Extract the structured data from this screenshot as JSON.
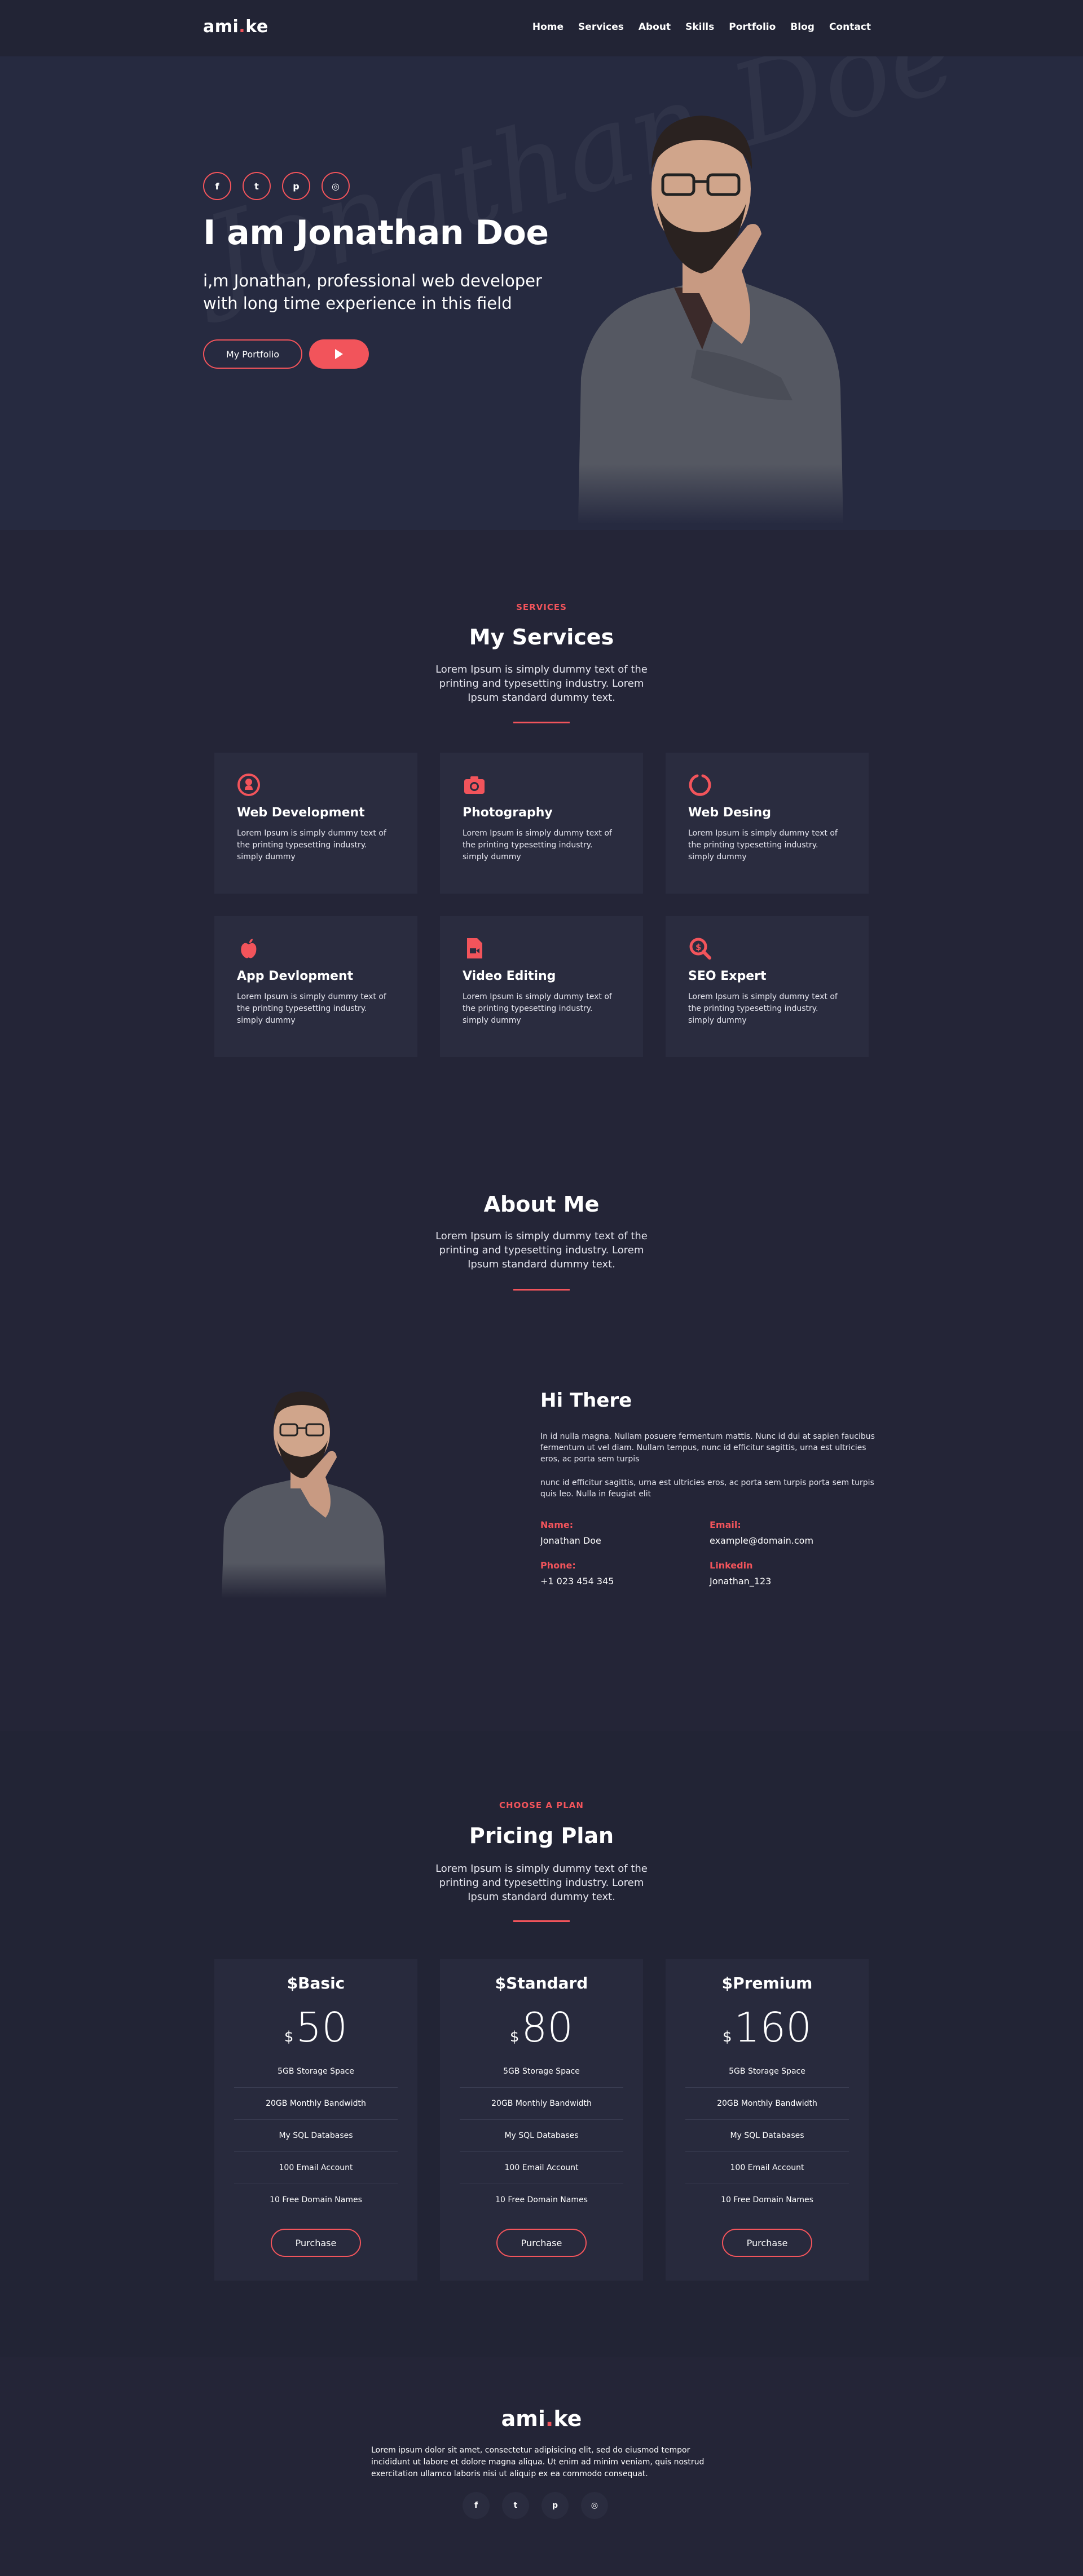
{
  "colors": {
    "accent": "#f2545b",
    "background": "#242537",
    "card": "#2a2c3f"
  },
  "nav": {
    "logo_left": "ami",
    "logo_dot": ".",
    "logo_right": "ke",
    "items": [
      "Home",
      "Services",
      "About",
      "Skills",
      "Portfolio",
      "Blog",
      "Contact"
    ]
  },
  "hero": {
    "social_icons": [
      "facebook-icon",
      "twitter-icon",
      "pinterest-icon",
      "instagram-icon"
    ],
    "social_glyphs": [
      "f",
      "t",
      "p",
      "◎"
    ],
    "title": "I am Jonathan Doe",
    "subtitle": "i,m Jonathan, professional web developer with long time experience in this field",
    "portfolio_button": "My Portfolio",
    "watermark": "Jonathan Doe"
  },
  "services": {
    "kicker": "SERVICES",
    "title": "My Services",
    "desc": "Lorem Ipsum is simply dummy text of the printing and typesetting industry. Lorem Ipsum standard dummy text.",
    "items": [
      {
        "icon": "github-icon",
        "title": "Web Development",
        "text": "Lorem Ipsum is simply dummy text of the printing typesetting industry. simply dummy"
      },
      {
        "icon": "camera-icon",
        "title": "Photography",
        "text": "Lorem Ipsum is simply dummy text of the printing typesetting industry. simply dummy"
      },
      {
        "icon": "circle-notch-icon",
        "title": "Web Desing",
        "text": "Lorem Ipsum is simply dummy text of the printing typesetting industry. simply dummy"
      },
      {
        "icon": "apple-icon",
        "title": "App Devlopment",
        "text": "Lorem Ipsum is simply dummy text of the printing typesetting industry. simply dummy"
      },
      {
        "icon": "video-file-icon",
        "title": "Video Editing",
        "text": "Lorem Ipsum is simply dummy text of the printing typesetting industry. simply dummy"
      },
      {
        "icon": "search-dollar-icon",
        "title": "SEO Expert",
        "text": "Lorem Ipsum is simply dummy text of the printing typesetting industry. simply dummy"
      }
    ]
  },
  "about": {
    "title": "About Me",
    "desc": "Lorem Ipsum is simply dummy text of the printing and typesetting industry. Lorem Ipsum standard dummy text.",
    "heading": "Hi There",
    "para1": "In id nulla magna. Nullam posuere fermentum mattis. Nunc id dui at sapien faucibus fermentum ut vel diam. Nullam tempus, nunc id efficitur sagittis, urna est ultricies eros, ac porta sem turpis",
    "para2": "nunc id efficitur sagittis, urna est ultricies eros, ac porta sem turpis porta sem turpis quis leo. Nulla in feugiat elit",
    "name_label": "Name:",
    "name": "Jonathan Doe",
    "email_label": "Email:",
    "email": "example@domain.com",
    "phone_label": "Phone:",
    "phone": "+1 023 454 345",
    "linkedin_label": "Linkedin",
    "linkedin": "Jonathan_123"
  },
  "pricing": {
    "kicker": "CHOOSE A PLAN",
    "title": "Pricing Plan",
    "desc": "Lorem Ipsum is simply dummy text of the printing and typesetting industry. Lorem Ipsum standard dummy text.",
    "currency": "$",
    "purchase_label": "Purchase",
    "plans": [
      {
        "name": "$Basic",
        "price": "50",
        "features": [
          "5GB Storage Space",
          "20GB Monthly Bandwidth",
          "My SQL Databases",
          "100 Email Account",
          "10 Free Domain Names"
        ]
      },
      {
        "name": "$Standard",
        "price": "80",
        "features": [
          "5GB Storage Space",
          "20GB Monthly Bandwidth",
          "My SQL Databases",
          "100 Email Account",
          "10 Free Domain Names"
        ]
      },
      {
        "name": "$Premium",
        "price": "160",
        "features": [
          "5GB Storage Space",
          "20GB Monthly Bandwidth",
          "My SQL Databases",
          "100 Email Account",
          "10 Free Domain Names"
        ]
      }
    ]
  },
  "footer": {
    "logo_left": "ami",
    "logo_dot": ".",
    "logo_right": "ke",
    "text": "Lorem ipsum dolor sit amet, consectetur adipisicing elit, sed do eiusmod tempor incididunt ut labore et dolore magna aliqua. Ut enim ad minim veniam, quis nostrud exercitation ullamco laboris nisi ut aliquip ex ea commodo consequat.",
    "social_icons": [
      "facebook-icon",
      "twitter-icon",
      "pinterest-icon",
      "instagram-icon"
    ]
  }
}
